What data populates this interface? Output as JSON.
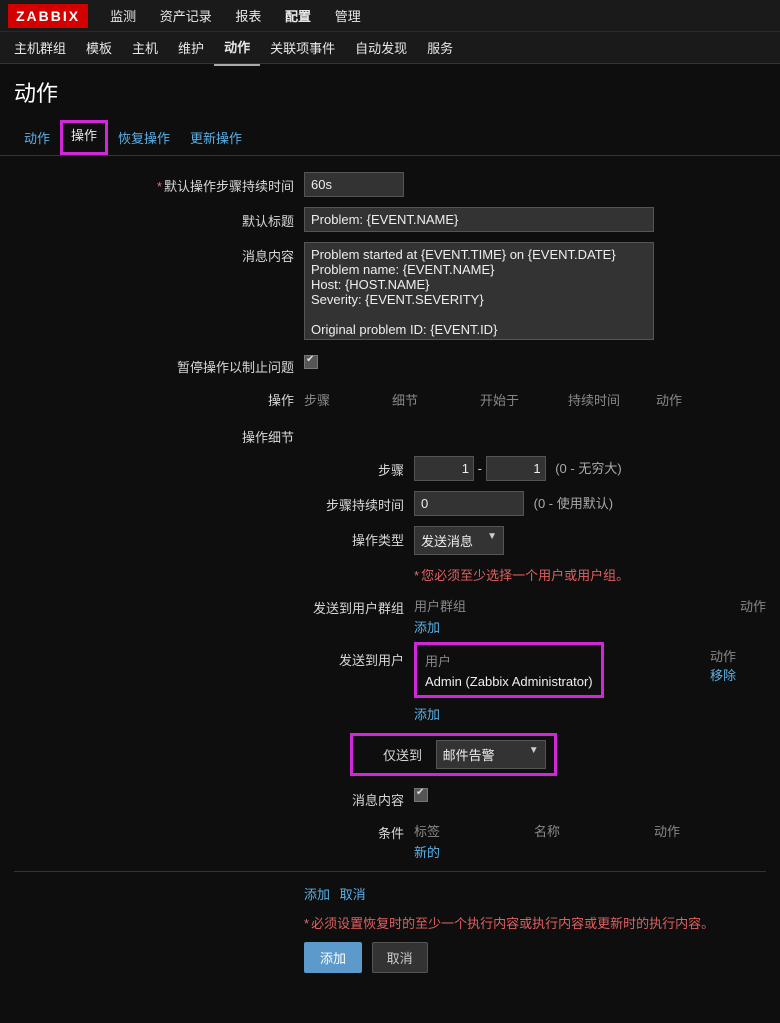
{
  "brand": "ZABBIX",
  "topnav": [
    "监测",
    "资产记录",
    "报表",
    "配置",
    "管理"
  ],
  "topnav_active": 3,
  "subnav": [
    "主机群组",
    "模板",
    "主机",
    "维护",
    "动作",
    "关联项事件",
    "自动发现",
    "服务"
  ],
  "subnav_active": 4,
  "page_title": "动作",
  "tabs": [
    "动作",
    "操作",
    "恢复操作",
    "更新操作"
  ],
  "tabs_active": 1,
  "form": {
    "default_step_duration_label": "默认操作步骤持续时间",
    "default_step_duration_value": "60s",
    "default_title_label": "默认标题",
    "default_title_value": "Problem: {EVENT.NAME}",
    "message_content_label": "消息内容",
    "message_content_value": "Problem started at {EVENT.TIME} on {EVENT.DATE}\nProblem name: {EVENT.NAME}\nHost: {HOST.NAME}\nSeverity: {EVENT.SEVERITY}\n\nOriginal problem ID: {EVENT.ID}\n{TRIGGER.URL}",
    "pause_label": "暂停操作以制止问题",
    "operations_label": "操作",
    "ops_headers": {
      "steps": "步骤",
      "detail": "细节",
      "start": "开始于",
      "duration": "持续时间",
      "action": "动作"
    },
    "op_detail_label": "操作细节",
    "steps_label": "步骤",
    "step_from": "1",
    "step_to": "1",
    "step_hint": "(0 - 无穷大)",
    "step_duration_label": "步骤持续时间",
    "step_duration_value": "0",
    "step_duration_hint": "(0 - 使用默认)",
    "op_type_label": "操作类型",
    "op_type_value": "发送消息",
    "warn_text": "您必须至少选择一个用户或用户组。",
    "send_group_label": "发送到用户群组",
    "usergroup_col": "用户群组",
    "action_col": "动作",
    "add_link": "添加",
    "send_user_label": "发送到用户",
    "user_col": "用户",
    "user_selected": "Admin (Zabbix Administrator)",
    "remove_link": "移除",
    "only_send_label": "仅送到",
    "only_send_value": "邮件告警",
    "msg_content_label": "消息内容",
    "conditions_label": "条件",
    "cond_headers": {
      "tag": "标签",
      "name": "名称",
      "action": "动作"
    },
    "new_link": "新的",
    "add_text": "添加",
    "cancel_text": "取消",
    "recover_note": "必须设置恢复时的至少一个执行内容或执行内容或更新时的执行内容。",
    "btn_add": "添加",
    "btn_cancel": "取消",
    "star": "*"
  }
}
